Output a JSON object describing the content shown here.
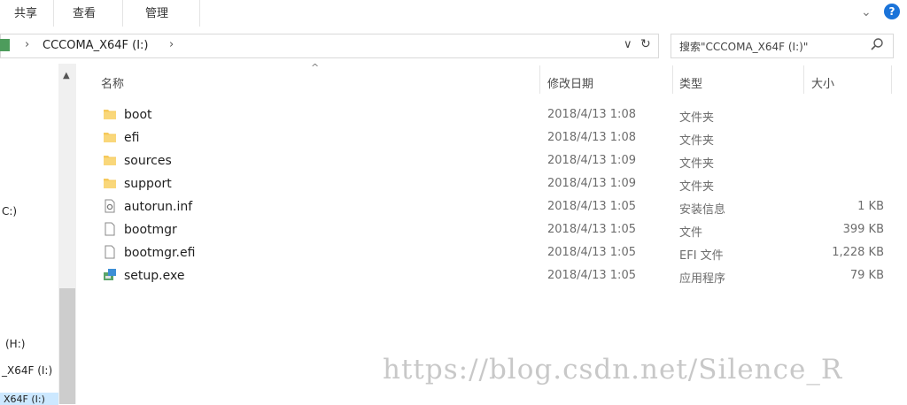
{
  "ribbon": {
    "tabs": [
      "共享",
      "查看",
      "管理"
    ]
  },
  "address": {
    "path": "CCCOMA_X64F (I:)",
    "separator": "›"
  },
  "search": {
    "placeholder": "搜索\"CCCOMA_X64F (I:)\""
  },
  "nav": {
    "items": [
      "C:)",
      "(H:)",
      "_X64F (I:)",
      "X64F (I:)"
    ]
  },
  "columns": {
    "name": "名称",
    "date": "修改日期",
    "type": "类型",
    "size": "大小"
  },
  "files": [
    {
      "name": "boot",
      "date": "2018/4/13 1:08",
      "type": "文件夹",
      "size": "",
      "icon": "folder-icon"
    },
    {
      "name": "efi",
      "date": "2018/4/13 1:08",
      "type": "文件夹",
      "size": "",
      "icon": "folder-icon"
    },
    {
      "name": "sources",
      "date": "2018/4/13 1:09",
      "type": "文件夹",
      "size": "",
      "icon": "folder-icon"
    },
    {
      "name": "support",
      "date": "2018/4/13 1:09",
      "type": "文件夹",
      "size": "",
      "icon": "folder-icon"
    },
    {
      "name": "autorun.inf",
      "date": "2018/4/13 1:05",
      "type": "安装信息",
      "size": "1 KB",
      "icon": "settings-file-icon"
    },
    {
      "name": "bootmgr",
      "date": "2018/4/13 1:05",
      "type": "文件",
      "size": "399 KB",
      "icon": "file-icon"
    },
    {
      "name": "bootmgr.efi",
      "date": "2018/4/13 1:05",
      "type": "EFI 文件",
      "size": "1,228 KB",
      "icon": "file-icon"
    },
    {
      "name": "setup.exe",
      "date": "2018/4/13 1:05",
      "type": "应用程序",
      "size": "79 KB",
      "icon": "setup-app-icon"
    }
  ],
  "watermark": "https://blog.csdn.net/Silence_R",
  "colors": {
    "folder": "#f6c95b",
    "accent": "#1a73d9",
    "selection": "#cce8ff"
  }
}
